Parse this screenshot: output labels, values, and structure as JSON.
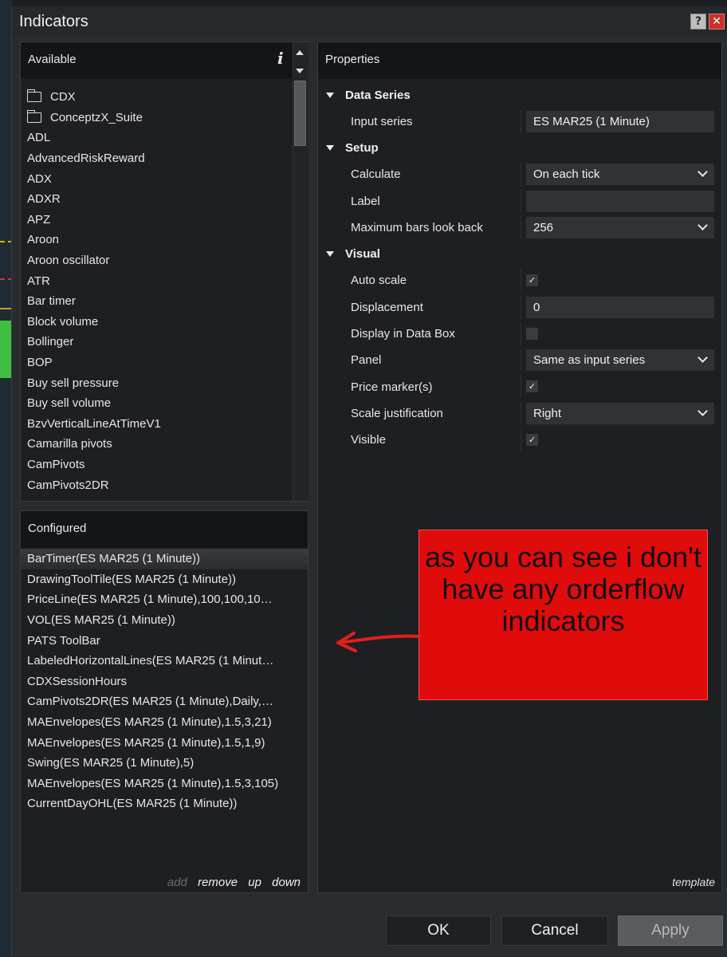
{
  "window": {
    "title": "Indicators",
    "help_label": "?",
    "close_label": "✕"
  },
  "available": {
    "header": "Available",
    "items": [
      {
        "label": "CDX",
        "folder": true
      },
      {
        "label": "ConceptzX_Suite",
        "folder": true
      },
      {
        "label": "ADL"
      },
      {
        "label": "AdvancedRiskReward"
      },
      {
        "label": "ADX"
      },
      {
        "label": "ADXR"
      },
      {
        "label": "APZ"
      },
      {
        "label": "Aroon"
      },
      {
        "label": "Aroon oscillator"
      },
      {
        "label": "ATR"
      },
      {
        "label": "Bar timer"
      },
      {
        "label": "Block volume"
      },
      {
        "label": "Bollinger"
      },
      {
        "label": "BOP"
      },
      {
        "label": "Buy sell pressure"
      },
      {
        "label": "Buy sell volume"
      },
      {
        "label": "BzvVerticalLineAtTimeV1"
      },
      {
        "label": "Camarilla pivots"
      },
      {
        "label": "CamPivots"
      },
      {
        "label": "CamPivots2DR"
      }
    ]
  },
  "configured": {
    "header": "Configured",
    "items": [
      "BarTimer(ES MAR25 (1 Minute))",
      "DrawingToolTile(ES MAR25 (1 Minute))",
      "PriceLine(ES MAR25 (1 Minute),100,100,10…",
      "VOL(ES MAR25 (1 Minute))",
      "PATS ToolBar",
      "LabeledHorizontalLines(ES MAR25 (1 Minut…",
      "CDXSessionHours",
      "CamPivots2DR(ES MAR25 (1 Minute),Daily,…",
      "MAEnvelopes(ES MAR25 (1 Minute),1.5,3,21)",
      "MAEnvelopes(ES MAR25 (1 Minute),1.5,1,9)",
      "Swing(ES MAR25 (1 Minute),5)",
      "MAEnvelopes(ES MAR25 (1 Minute),1.5,3,105)",
      "CurrentDayOHL(ES MAR25 (1 Minute))"
    ],
    "selected_index": 0,
    "actions": {
      "add": "add",
      "remove": "remove",
      "up": "up",
      "down": "down"
    }
  },
  "properties": {
    "header": "Properties",
    "template_label": "template",
    "sections": {
      "data_series": {
        "title": "Data Series",
        "input_series": {
          "label": "Input series",
          "value": "ES MAR25 (1 Minute)"
        }
      },
      "setup": {
        "title": "Setup",
        "calculate": {
          "label": "Calculate",
          "value": "On each tick"
        },
        "label_field": {
          "label": "Label",
          "value": ""
        },
        "max_bars": {
          "label": "Maximum bars look back",
          "value": "256"
        }
      },
      "visual": {
        "title": "Visual",
        "auto_scale": {
          "label": "Auto scale",
          "checked": true
        },
        "displacement": {
          "label": "Displacement",
          "value": "0"
        },
        "display_in_data_box": {
          "label": "Display in Data Box",
          "checked": false
        },
        "panel": {
          "label": "Panel",
          "value": "Same as input series"
        },
        "price_markers": {
          "label": "Price marker(s)",
          "checked": true
        },
        "scale_justification": {
          "label": "Scale justification",
          "value": "Right"
        },
        "visible": {
          "label": "Visible",
          "checked": true
        }
      }
    }
  },
  "buttons": {
    "ok": "OK",
    "cancel": "Cancel",
    "apply": "Apply"
  },
  "annotation": {
    "text": "as you can see i don't have any orderflow indicators",
    "color": "#e00b0b"
  },
  "check_glyph": "✓"
}
